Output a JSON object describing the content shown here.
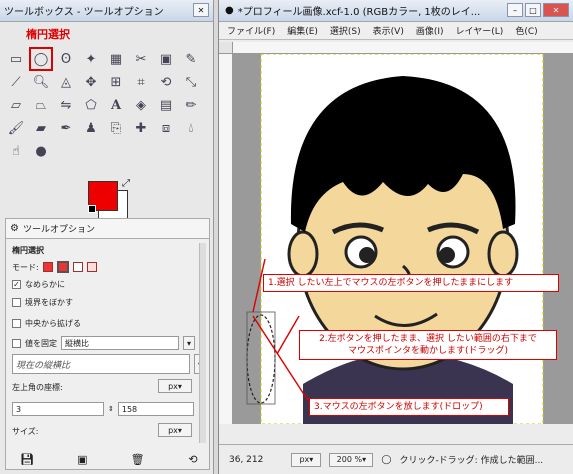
{
  "toolbox": {
    "title": "ツールボックス - ツールオプション",
    "section_label": "楕円選択"
  },
  "tool_options": {
    "tab_label": "ツールオプション",
    "tool_name": "楕円選択",
    "mode_label": "モード:",
    "antialias_label": "なめらかに",
    "feather_label": "境界をぼかす",
    "expand_center_label": "中央から拡げる",
    "fixed_label": "値を固定",
    "fixed_value": "縦横比",
    "current_ratio_label": "現在の縦横比",
    "position_label": "左上角の座標:",
    "position_unit": "px",
    "pos_x": "3",
    "pos_y": "158",
    "size_label": "サイズ:",
    "size_unit": "px"
  },
  "image_window": {
    "title": "*プロフィール画像.xcf-1.0 (RGBカラー, 1枚のレイ...",
    "menu": [
      "ファイル(F)",
      "編集(E)",
      "選択(S)",
      "表示(V)",
      "画像(I)",
      "レイヤー(L)",
      "色(C)"
    ]
  },
  "status": {
    "coords": "36, 212",
    "unit": "px",
    "zoom": "200 %",
    "message": "クリック-ドラッグ: 作成した範囲..."
  },
  "annotations": {
    "step1": "1.選択 したい左上でマウスの左ボタンを押したままにします",
    "step2_line1": "2.左ボタンを押したまま、選択 したい範囲の右下まで",
    "step2_line2": "マウスポインタを動かします(ドラッグ)",
    "step3": "3.マウスの左ボタンを放します(ドロップ)"
  },
  "colors": {
    "foreground": "#ee0000",
    "background": "#ffffff",
    "annotation": "#dd0000"
  }
}
